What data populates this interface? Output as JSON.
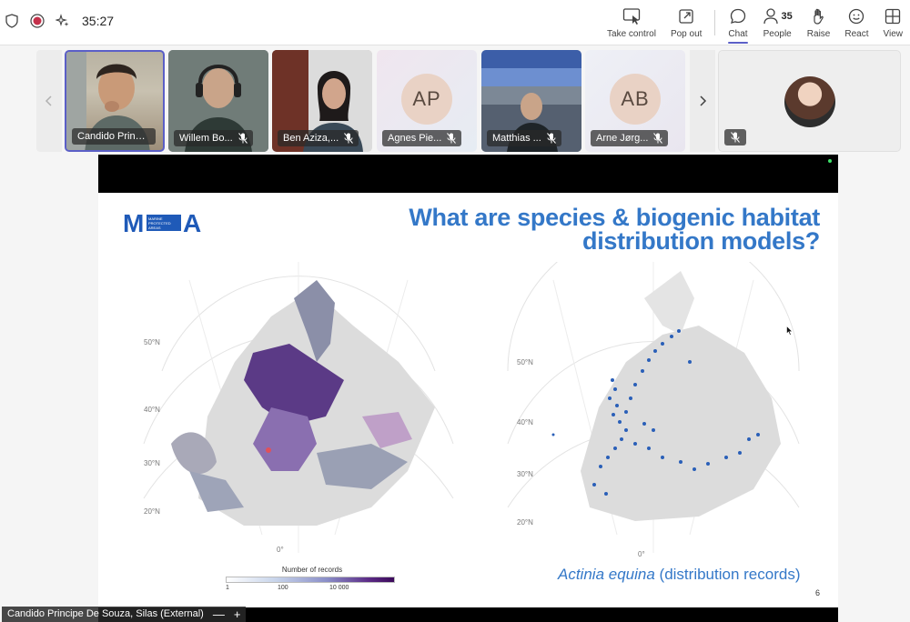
{
  "toolbar": {
    "timer": "35:27",
    "actions": {
      "take_control": "Take control",
      "pop_out": "Pop out",
      "chat": "Chat",
      "people": "People",
      "people_count": "35",
      "raise": "Raise",
      "react": "React",
      "view": "View"
    }
  },
  "participants": [
    {
      "name": "Candido Princi...",
      "muted": false
    },
    {
      "name": "Willem Bo...",
      "muted": true
    },
    {
      "name": "Ben Aziza,...",
      "muted": true
    },
    {
      "name": "Agnes Pie...",
      "initials": "AP",
      "muted": true
    },
    {
      "name": "Matthias ...",
      "muted": true
    },
    {
      "name": "Arne Jørg...",
      "initials": "AB",
      "muted": true
    }
  ],
  "slide": {
    "logo_text": "MPA",
    "logo_small": "MARINE PROTECTED AREAS EUROPE",
    "title_line1": "What are species & biogenic habitat",
    "title_line2": "distribution models?",
    "lat_left": [
      "50°N",
      "40°N",
      "30°N",
      "20°N",
      "0°"
    ],
    "lat_right": [
      "50°N",
      "40°N",
      "30°N",
      "20°N",
      "0°"
    ],
    "legend_title": "Number of records",
    "legend_ticks": [
      "1",
      "100",
      "10 000"
    ],
    "caption_species": "Actinia equina",
    "caption_rest": " (distribution records)",
    "page_number": "6"
  },
  "presenter": {
    "name": "Candido Principe De Souza, Silas (External)",
    "minimize": "—",
    "expand": "+"
  },
  "colors": {
    "accent": "#5b5fc7",
    "slide_blue": "#3478c8",
    "records_purple": "#5b2a86",
    "dots_blue": "#2a5fb8"
  }
}
